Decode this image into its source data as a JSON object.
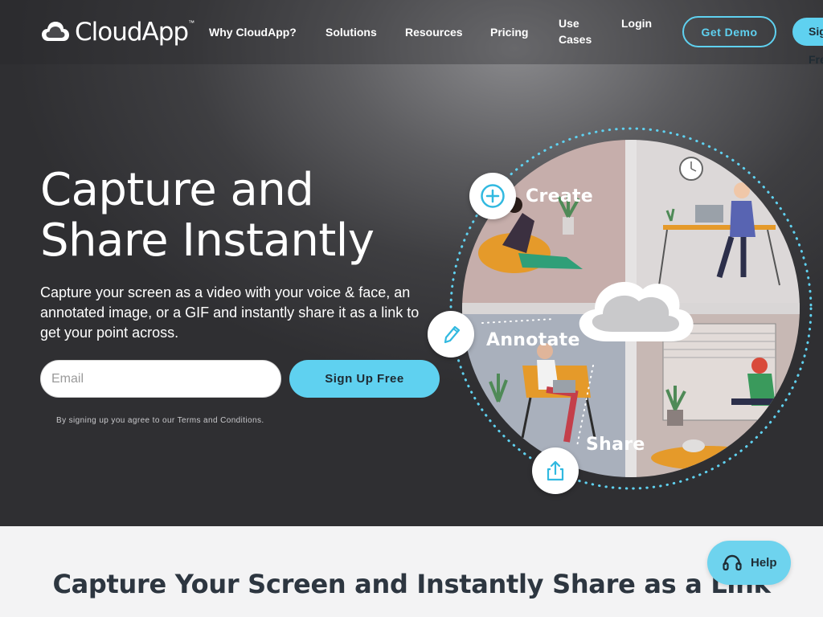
{
  "brand": {
    "name": "CloudApp",
    "trademark": "™",
    "accent_color": "#5fd1f0"
  },
  "nav": {
    "items": [
      {
        "label": "Why CloudApp?"
      },
      {
        "label": "Solutions"
      },
      {
        "label": "Resources"
      },
      {
        "label": "Pricing"
      },
      {
        "label": "Use Cases"
      },
      {
        "label": "Login"
      }
    ],
    "demo_label": "Get Demo",
    "signup_label": "Sign Up Free"
  },
  "hero": {
    "title": "Capture and Share Instantly",
    "subtitle": "Capture your screen as a video with your voice & face, an annotated image, or a GIF and instantly share it as a link to get your point across.",
    "email_placeholder": "Email",
    "email_value": "",
    "cta_label": "Sign Up Free",
    "terms_text": "By signing up you agree to our ",
    "terms_link": "Terms and Conditions",
    "terms_end": "."
  },
  "illustration": {
    "steps": [
      {
        "label": "Create",
        "icon": "plus-circle-icon"
      },
      {
        "label": "Annotate",
        "icon": "pencil-icon"
      },
      {
        "label": "Share",
        "icon": "share-upload-icon"
      }
    ],
    "center_icon": "cloud-icon"
  },
  "section2": {
    "title": "Capture Your Screen and Instantly Share as a Link"
  },
  "help_widget": {
    "label": "Help",
    "icon": "headset-icon"
  }
}
